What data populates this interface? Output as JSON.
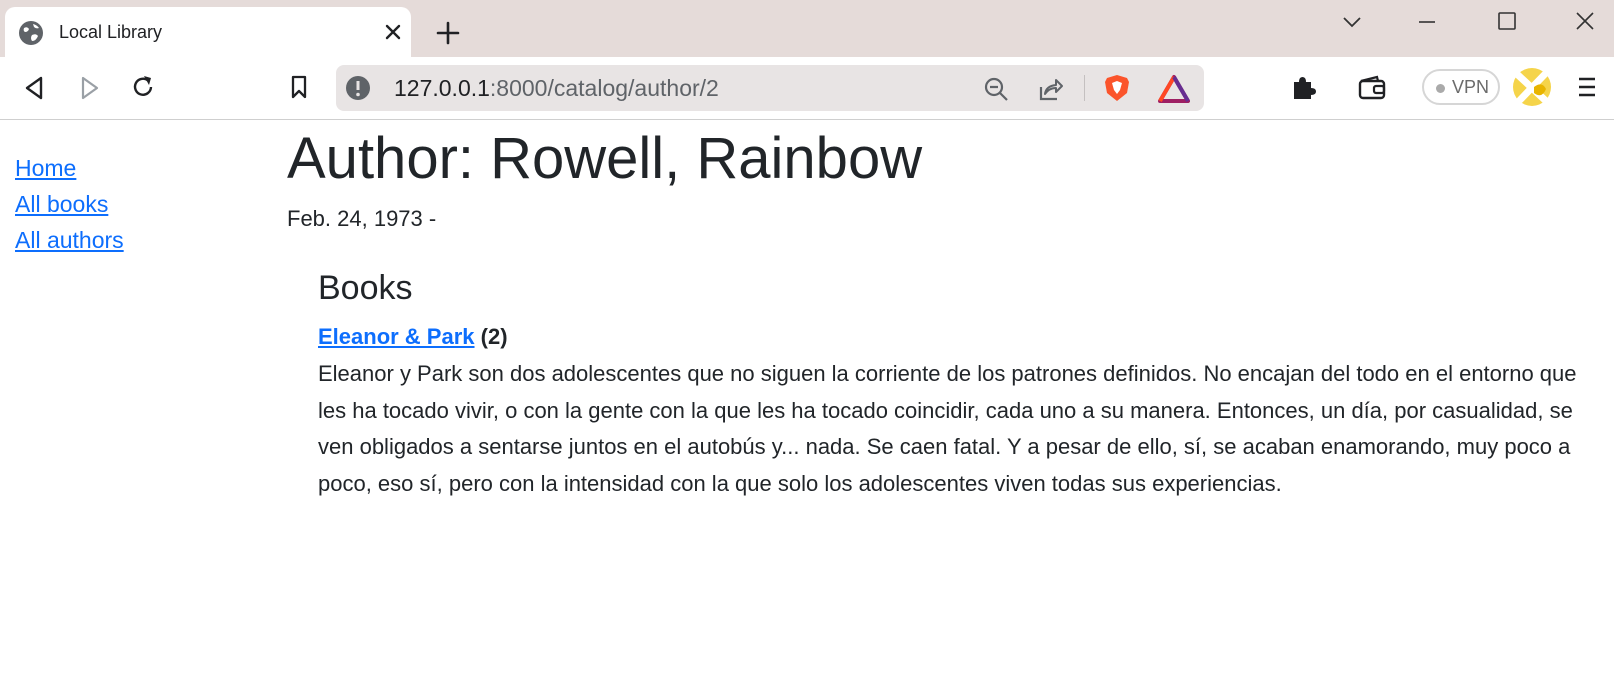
{
  "browser": {
    "tab_title": "Local Library",
    "url_host": "127.0.0.1",
    "url_path": ":8000/catalog/author/2",
    "vpn_label": "VPN"
  },
  "sidebar": {
    "links": [
      "Home",
      "All books",
      "All authors"
    ]
  },
  "author": {
    "heading": "Author: Rowell, Rainbow",
    "dates": "Feb. 24, 1973 -"
  },
  "books_section": {
    "heading": "Books",
    "items": [
      {
        "title": "Eleanor & Park",
        "count": "(2)",
        "summary": "Eleanor y Park son dos adolescentes que no siguen la corriente de los patrones definidos. No encajan del todo en el entorno que les ha tocado vivir, o con la gente con la que les ha tocado coincidir, cada uno a su manera. Entonces, un día, por casualidad, se ven obligados a sentarse juntos en el autobús y... nada. Se caen fatal. Y a pesar de ello, sí, se acaban enamorando, muy poco a poco, eso sí, pero con la intensidad con la que solo los adolescentes viven todas sus experiencias."
      }
    ]
  },
  "colors": {
    "link": "#0d6efd",
    "titlebar": "#e5dbd9",
    "brave_orange": "#fb542b"
  },
  "icons": [
    "globe-icon",
    "close-icon",
    "plus-icon",
    "chevron-down-icon",
    "minimize-icon",
    "maximize-icon",
    "back-icon",
    "forward-icon",
    "reload-icon",
    "bookmark-icon",
    "info-icon",
    "zoom-out-icon",
    "share-icon",
    "brave-shield-icon",
    "rewards-icon",
    "extensions-icon",
    "wallet-icon",
    "profile-icon",
    "menu-icon"
  ]
}
